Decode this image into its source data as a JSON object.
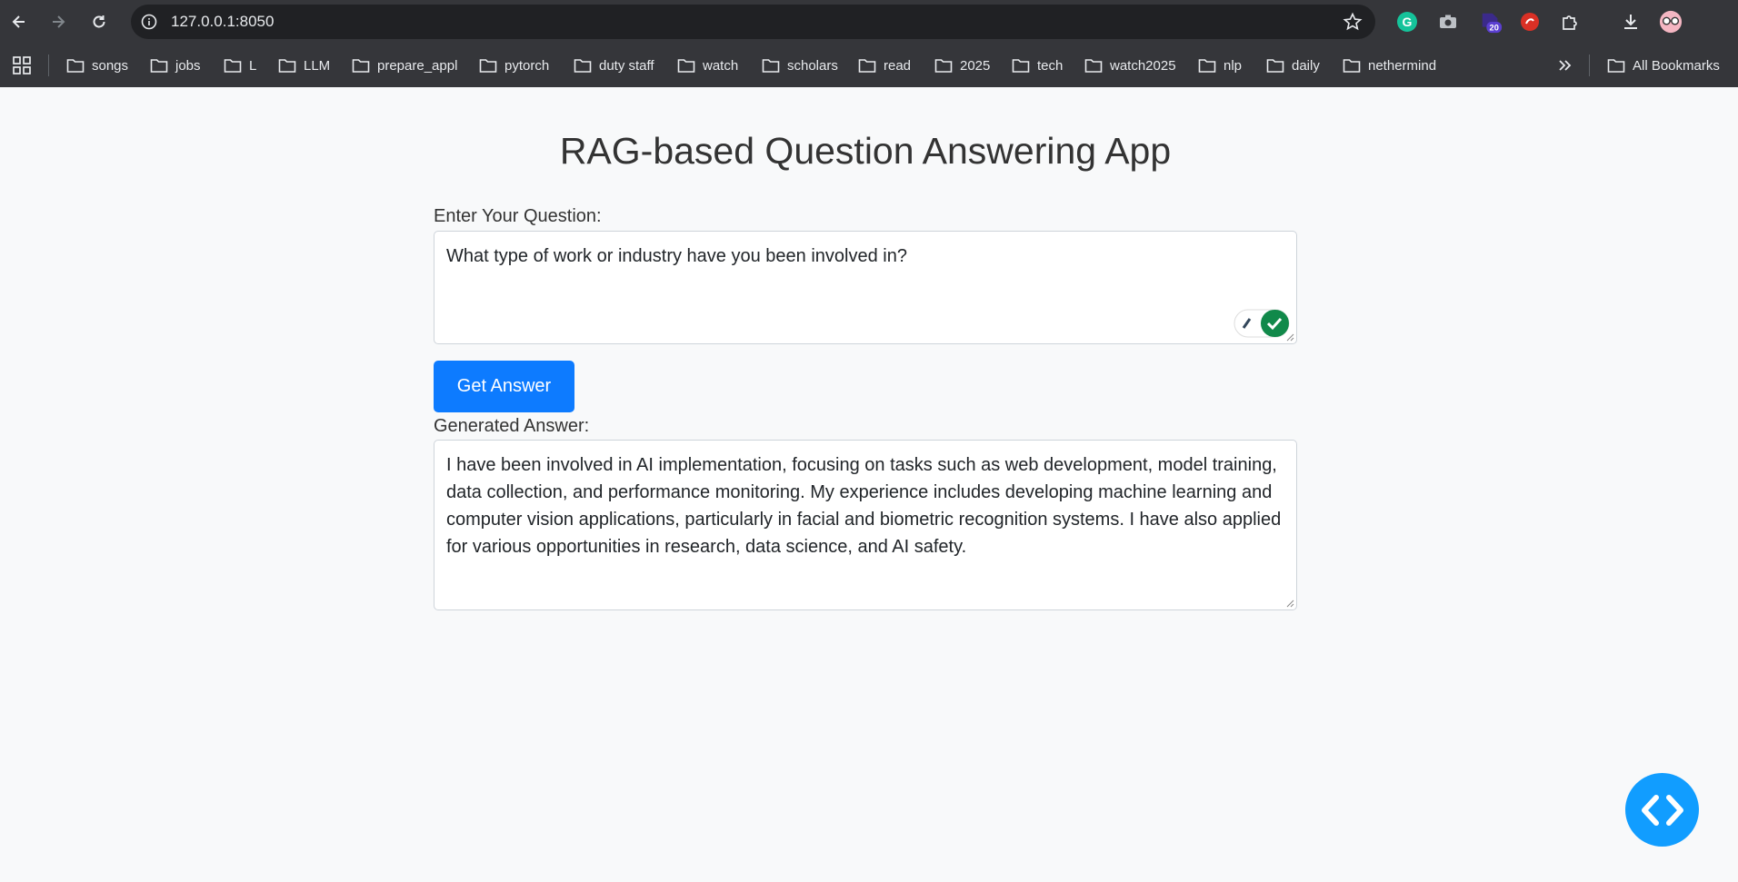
{
  "browser": {
    "url": "127.0.0.1:8050",
    "extension_badge": "20",
    "bookmarks": [
      "songs",
      "jobs",
      "L",
      "LLM",
      "prepare_appl",
      "pytorch",
      "duty staff",
      "watch",
      "scholars",
      "read",
      "2025",
      "tech",
      "watch2025",
      "nlp",
      "daily",
      "nethermind"
    ],
    "all_bookmarks_label": "All Bookmarks"
  },
  "app": {
    "title": "RAG-based Question Answering App",
    "question_label": "Enter Your Question:",
    "question_value": "What type of work or industry have you been involved in?",
    "submit_label": "Get Answer",
    "answer_label": "Generated Answer:",
    "answer_value": "I have been involved in AI implementation, focusing on tasks such as web development, model training, data collection, and performance monitoring. My experience includes developing machine learning and computer vision applications, particularly in facial and biometric recognition systems. I have also applied for various opportunities in research, data science, and AI safety."
  },
  "colors": {
    "primary_button": "#0d7bff",
    "devtools_fab": "#119dff",
    "chrome_bg": "#35363a",
    "page_bg": "#f8f9fa"
  },
  "icons": [
    "back-arrow-icon",
    "forward-arrow-icon",
    "reload-icon",
    "site-info-icon",
    "bookmark-star-icon",
    "grammarly-icon",
    "camera-icon",
    "extension-badge-icon",
    "red-extension-icon",
    "extensions-puzzle-icon",
    "download-icon",
    "profile-avatar-icon",
    "apps-grid-icon",
    "folder-icon",
    "chevron-double-right-icon",
    "code-brackets-icon"
  ]
}
